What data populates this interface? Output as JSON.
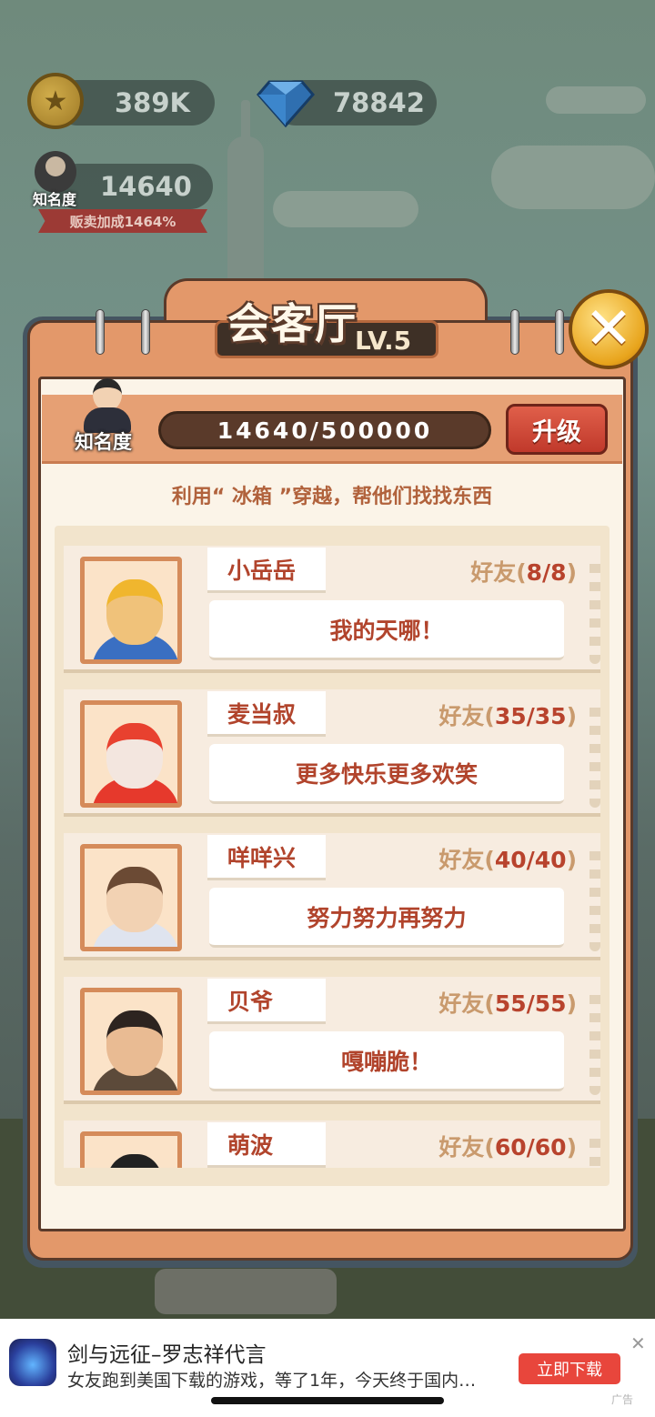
{
  "hud": {
    "coins": "389K",
    "gems": "78842",
    "fame_label": "知名度",
    "fame_value": "14640",
    "bonus": "贩卖加成1464%"
  },
  "dialog": {
    "title": "会客厅",
    "level": "LV.5",
    "fame_label": "知名度",
    "progress_text": "14640/500000",
    "progress_fraction": 0.0293,
    "upgrade_label": "升级",
    "subtitle": "利用“ 冰箱 ”穿越，帮他们找找东西",
    "characters": [
      {
        "name": "小岳岳",
        "friends_label": "好友(",
        "friends_count": "8/8",
        "friends_close": ")",
        "quote": "我的天哪！",
        "palette": "yellow-scarf"
      },
      {
        "name": "麦当叔",
        "friends_label": "好友(",
        "friends_count": "35/35",
        "friends_close": ")",
        "quote": "更多快乐更多欢笑",
        "palette": "clown"
      },
      {
        "name": "咩咩兴",
        "friends_label": "好友(",
        "friends_count": "40/40",
        "friends_close": ")",
        "quote": "努力努力再努力",
        "palette": "brown-hair"
      },
      {
        "name": "贝爷",
        "friends_label": "好友(",
        "friends_count": "55/55",
        "friends_close": ")",
        "quote": "嘎嘣脆！",
        "palette": "survivor"
      },
      {
        "name": "萌波",
        "friends_label": "好友(",
        "friends_count": "60/60",
        "friends_close": ")",
        "quote": "",
        "palette": "panda"
      }
    ]
  },
  "ad": {
    "title": "剑与远征–罗志祥代言",
    "description": "女友跑到美国下载的游戏，等了1年，今天终于国内…",
    "button": "立即下载",
    "close_icon": "✕",
    "label": "广告"
  },
  "colors": {
    "accent_red": "#c0392b",
    "panel_orange": "#e3986a",
    "text_red": "#b1442c"
  }
}
